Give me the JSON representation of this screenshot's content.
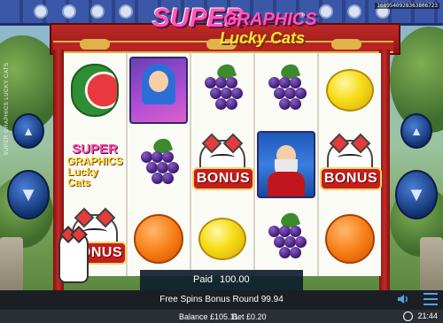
{
  "game": {
    "logo_super": "SUPER",
    "logo_graphics": "GRAPHICS",
    "logo_lucky": "Lucky Cats",
    "logo_tm": "®",
    "game_id": "1689540928363806723",
    "vertical_label": "SUPER GRAPHICS LUCKY CATS"
  },
  "reels": [
    [
      "watermelon",
      "logo",
      "lucky-cat-bonus"
    ],
    [
      "blue-haired-girl",
      "grapes",
      "orange"
    ],
    [
      "grapes",
      "lucky-cat-bonus",
      "lemon"
    ],
    [
      "grapes",
      "warrior",
      "grapes"
    ],
    [
      "lemon",
      "lucky-cat-bonus",
      "orange"
    ]
  ],
  "symbol_text": {
    "bonus": "BONUS",
    "logo_l1": "SUPER",
    "logo_l2": "GRAPHICS",
    "logo_l3": "Lucky Cats"
  },
  "win_panel": {
    "paid_label": "Paid",
    "paid_value": "100.00"
  },
  "status": {
    "free_spins_text": "Free Spins Bonus Round 99.94"
  },
  "footer": {
    "balance": "Balance £105.11",
    "bet": "Bet £0.20",
    "clock": "21:44"
  },
  "controls": {
    "up_arrow": "▲",
    "down_arrow": "▼"
  },
  "colors": {
    "frame_red": "#c02a28",
    "accent_blue": "#4fa3e8",
    "bonus_red": "#c61e1e"
  }
}
